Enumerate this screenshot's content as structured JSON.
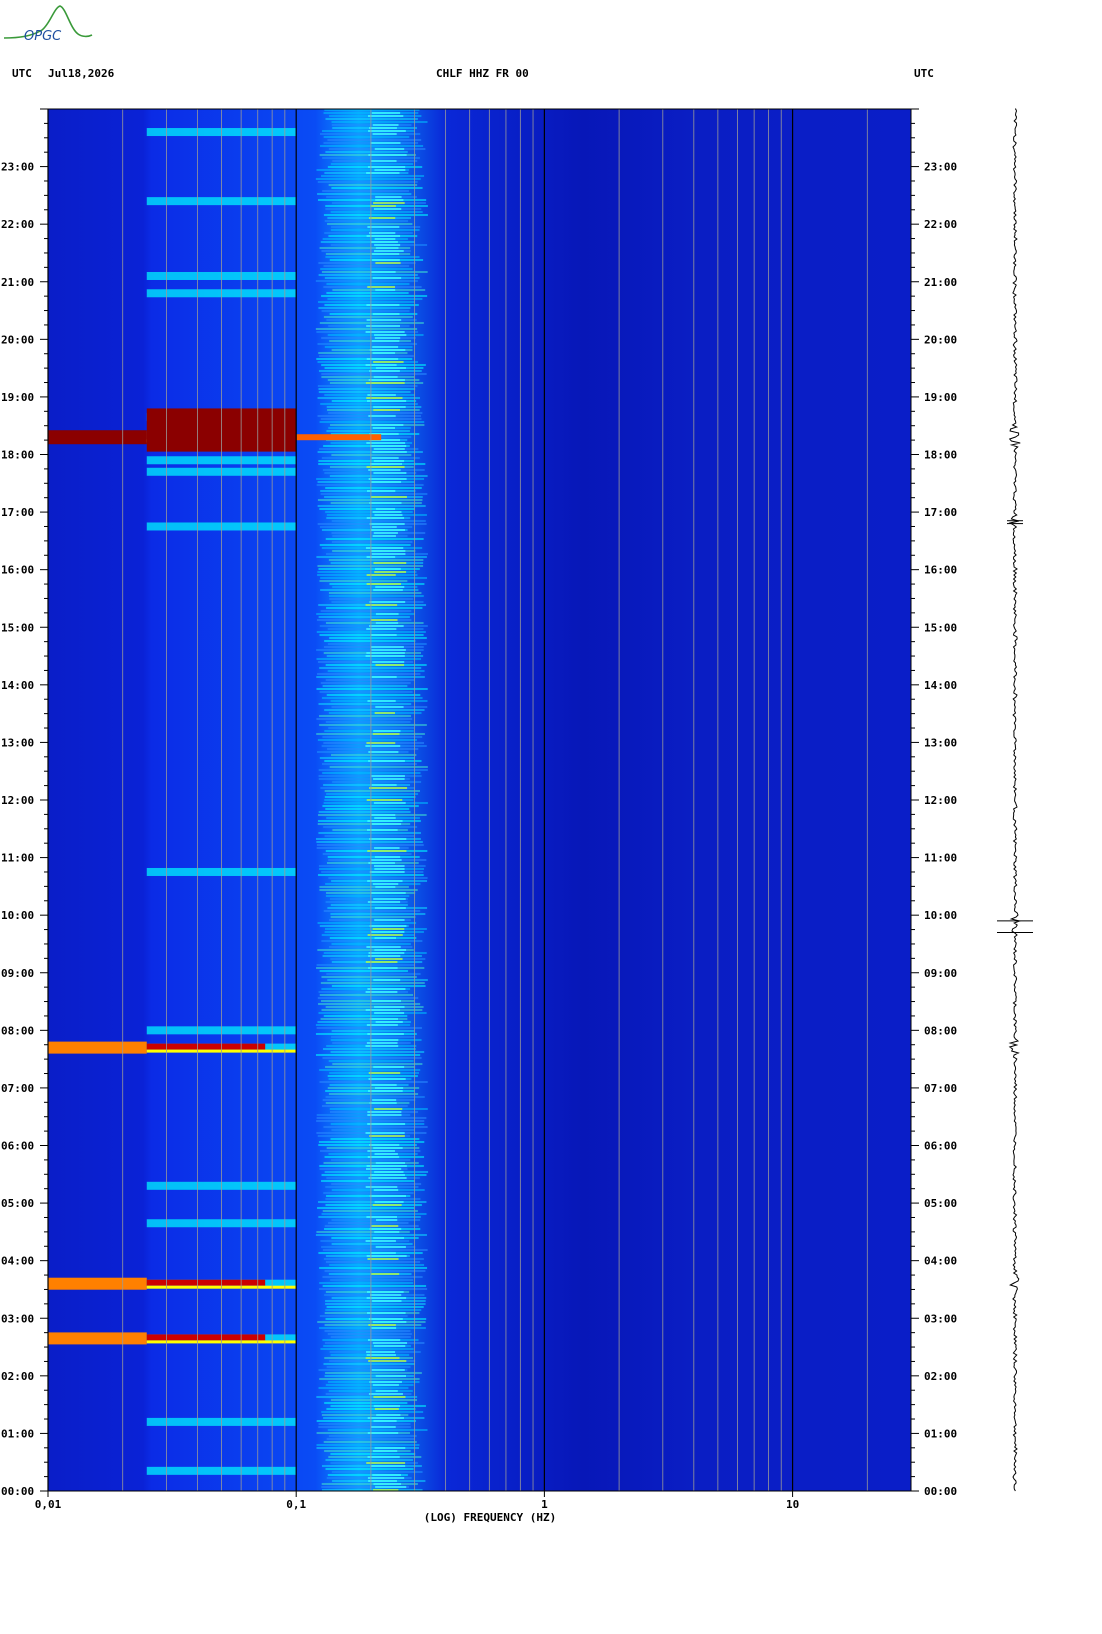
{
  "logo": {
    "text": "OPGC",
    "color": "#1f4fa0",
    "accent": "#3a9a3a"
  },
  "header": {
    "left_tz": "UTC",
    "date": "Jul18,2026",
    "station": "CHLF HHZ FR 00",
    "right_tz": "UTC"
  },
  "chart_data": {
    "type": "heatmap",
    "title": "CHLF HHZ FR 00",
    "xlabel": "(LOG) FREQUENCY (HZ)",
    "ylabel": "",
    "x_scale": "log",
    "xlim": [
      0.01,
      30
    ],
    "x_ticks": [
      "0,01",
      "0,1",
      "1",
      "10"
    ],
    "x_tick_values": [
      0.01,
      0.1,
      1,
      10
    ],
    "y_ticks": [
      "00:00",
      "01:00",
      "02:00",
      "03:00",
      "04:00",
      "05:00",
      "06:00",
      "07:00",
      "08:00",
      "09:00",
      "10:00",
      "11:00",
      "12:00",
      "13:00",
      "14:00",
      "15:00",
      "16:00",
      "17:00",
      "18:00",
      "19:00",
      "20:00",
      "21:00",
      "22:00",
      "23:00"
    ],
    "ylim_hours": [
      0,
      24
    ],
    "colormap": [
      "#00008b",
      "#0000ff",
      "#00bfff",
      "#00ffff",
      "#ffff00",
      "#ff0000",
      "#8b0000"
    ],
    "events_utc_hours": [
      0.35,
      1.2,
      2.65,
      3.6,
      4.65,
      5.3,
      7.7,
      8.0,
      10.75,
      16.75,
      17.7,
      17.9,
      18.3,
      18.65,
      20.8,
      21.1,
      22.4,
      23.6
    ]
  },
  "seismogram": {
    "event_hours": [
      18.3,
      16.8,
      9.9,
      7.7,
      3.6
    ],
    "color": "#000000"
  }
}
